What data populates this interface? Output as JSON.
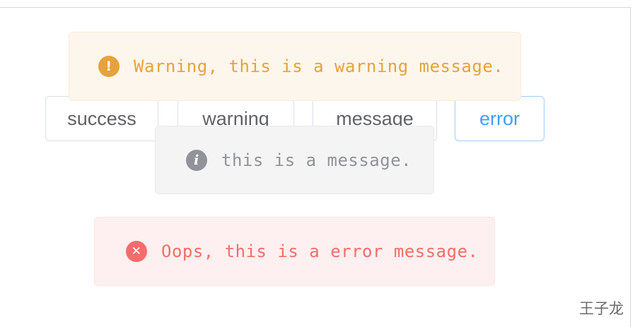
{
  "buttons": {
    "success_label": "success",
    "warning_label": "warning",
    "message_label": "message",
    "error_label": "error"
  },
  "messages": {
    "warning": {
      "text": "Warning, this is a warning message.",
      "icon": "warning-circle-icon",
      "icon_glyph": "!",
      "color": "#e6a23c"
    },
    "info": {
      "text": "this is a message.",
      "icon": "info-circle-icon",
      "icon_glyph": "i",
      "color": "#909399"
    },
    "error": {
      "text": "Oops, this is a error message.",
      "icon": "error-circle-icon",
      "icon_glyph": "✕",
      "color": "#f56c6c"
    }
  },
  "watermark": "王子龙",
  "colors": {
    "primary": "#409eff",
    "warning": "#e6a23c",
    "info": "#909399",
    "danger": "#f56c6c"
  }
}
